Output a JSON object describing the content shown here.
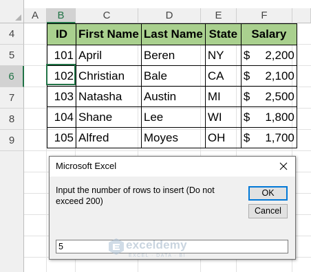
{
  "columns": [
    "A",
    "B",
    "C",
    "D",
    "E",
    "F"
  ],
  "selected_column": "B",
  "rows": [
    "4",
    "5",
    "6",
    "7",
    "8",
    "9"
  ],
  "selected_row": "6",
  "table": {
    "headers": [
      "ID",
      "First Name",
      "Last Name",
      "State",
      "Salary"
    ],
    "records": [
      {
        "id": "101",
        "first": "April",
        "last": "Beren",
        "state": "NY",
        "currency": "$",
        "salary": "2,200"
      },
      {
        "id": "102",
        "first": "Christian",
        "last": "Bale",
        "state": "CA",
        "currency": "$",
        "salary": "2,100"
      },
      {
        "id": "103",
        "first": "Natasha",
        "last": "Austin",
        "state": "MI",
        "currency": "$",
        "salary": "2,500"
      },
      {
        "id": "104",
        "first": "Shane",
        "last": "Lee",
        "state": "WI",
        "currency": "$",
        "salary": "1,800"
      },
      {
        "id": "105",
        "first": "Alfred",
        "last": "Moyes",
        "state": "OH",
        "currency": "$",
        "salary": "1,700"
      }
    ],
    "header_fill": "#a9d08e"
  },
  "dialog": {
    "title": "Microsoft Excel",
    "prompt": "Input the number of rows to insert (Do not exceed 200)",
    "ok_label": "OK",
    "cancel_label": "Cancel",
    "input_value": "5",
    "close_icon": "close-icon"
  },
  "watermark": {
    "name": "exceldemy",
    "tagline": "EXCEL · DATA · BI",
    "icon": "exceldemy-logo-icon"
  },
  "colors": {
    "accent": "#217346",
    "focus": "#0078d7"
  }
}
